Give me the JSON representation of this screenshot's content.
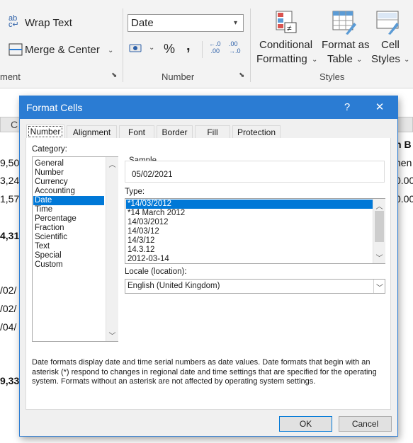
{
  "ribbon": {
    "wrap_text": "Wrap Text",
    "merge_center": "Merge & Center",
    "alignment_group_fragment": "ment",
    "number_format_value": "Date",
    "number_group": "Number",
    "percent": "%",
    "comma": ",",
    "increase_decimal": "←.0 .00",
    "decrease_decimal": ".00 →.0",
    "conditional_formatting_line1": "Conditional",
    "conditional_formatting_line2": "Formatting",
    "format_as_table_line1": "Format as",
    "format_as_table_line2": "Table",
    "cell_styles_line1": "Cell",
    "cell_styles_line2": "Styles",
    "styles_group": "Styles"
  },
  "sheet": {
    "column_c": "C",
    "cells_left": [
      "9,50",
      "3,24",
      "1,57",
      "4,31",
      "/02/",
      "/02/",
      "/04/",
      "9,33"
    ],
    "cells_right": [
      "h B",
      "hen",
      "0.00",
      "0.00"
    ]
  },
  "dialog": {
    "title": "Format Cells",
    "help": "?",
    "close": "✕",
    "tabs": [
      "Number",
      "Alignment",
      "Font",
      "Border",
      "Fill",
      "Protection"
    ],
    "category_label": "Category:",
    "categories": [
      "General",
      "Number",
      "Currency",
      "Accounting",
      "Date",
      "Time",
      "Percentage",
      "Fraction",
      "Scientific",
      "Text",
      "Special",
      "Custom"
    ],
    "selected_category": "Date",
    "sample_label": "Sample",
    "sample_value": "05/02/2021",
    "type_label": "Type:",
    "types": [
      "*14/03/2012",
      "*14 March 2012",
      "14/03/2012",
      "14/03/12",
      "14/3/12",
      "14.3.12",
      "2012-03-14"
    ],
    "selected_type": "*14/03/2012",
    "locale_label": "Locale (location):",
    "locale_value": "English (United Kingdom)",
    "description": "Date formats display date and time serial numbers as date values.  Date formats that begin with an asterisk (*) respond to changes in regional date and time settings that are specified for the operating system. Formats without an asterisk are not affected by operating system settings.",
    "ok": "OK",
    "cancel": "Cancel"
  },
  "colors": {
    "accent": "#2b7cd3",
    "selection": "#0078d7"
  }
}
